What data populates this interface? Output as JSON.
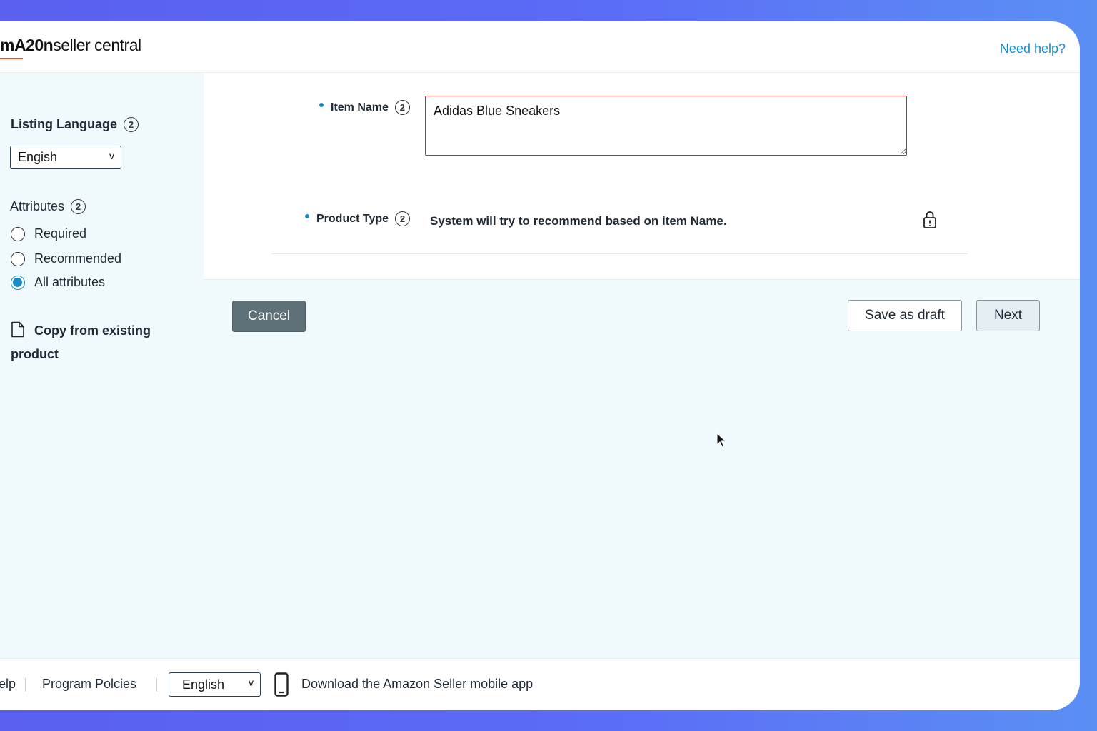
{
  "header": {
    "logo_brand": "mA20n",
    "logo_rest": "seller central",
    "need_help": "Need help?"
  },
  "sidebar": {
    "listing_language_label": "Listing Language",
    "listing_language_value": "Engish",
    "attributes_label": "Attributes",
    "attribute_options": [
      {
        "label": "Required",
        "checked": false
      },
      {
        "label": "Recommended",
        "checked": false
      },
      {
        "label": "All attributes",
        "checked": true
      }
    ],
    "copy_label": "Copy from existing product"
  },
  "form": {
    "item_name_label": "Item Name",
    "item_name_value": "Adidas Blue Sneakers",
    "product_type_label": "Product Type",
    "product_type_text": "System will try to recommend based on item Name."
  },
  "actions": {
    "cancel": "Cancel",
    "save_draft": "Save as draft",
    "next": "Next"
  },
  "footer": {
    "help_fragment": "elp",
    "program_policies": "Program Polcies",
    "language_value": "English",
    "download_app": "Download the Amazon Seller mobile app"
  },
  "colors": {
    "accent": "#1a8bc4",
    "error_border": "#cc2a2a",
    "cancel_button": "#5e7178",
    "background": "#f0f9fc"
  }
}
